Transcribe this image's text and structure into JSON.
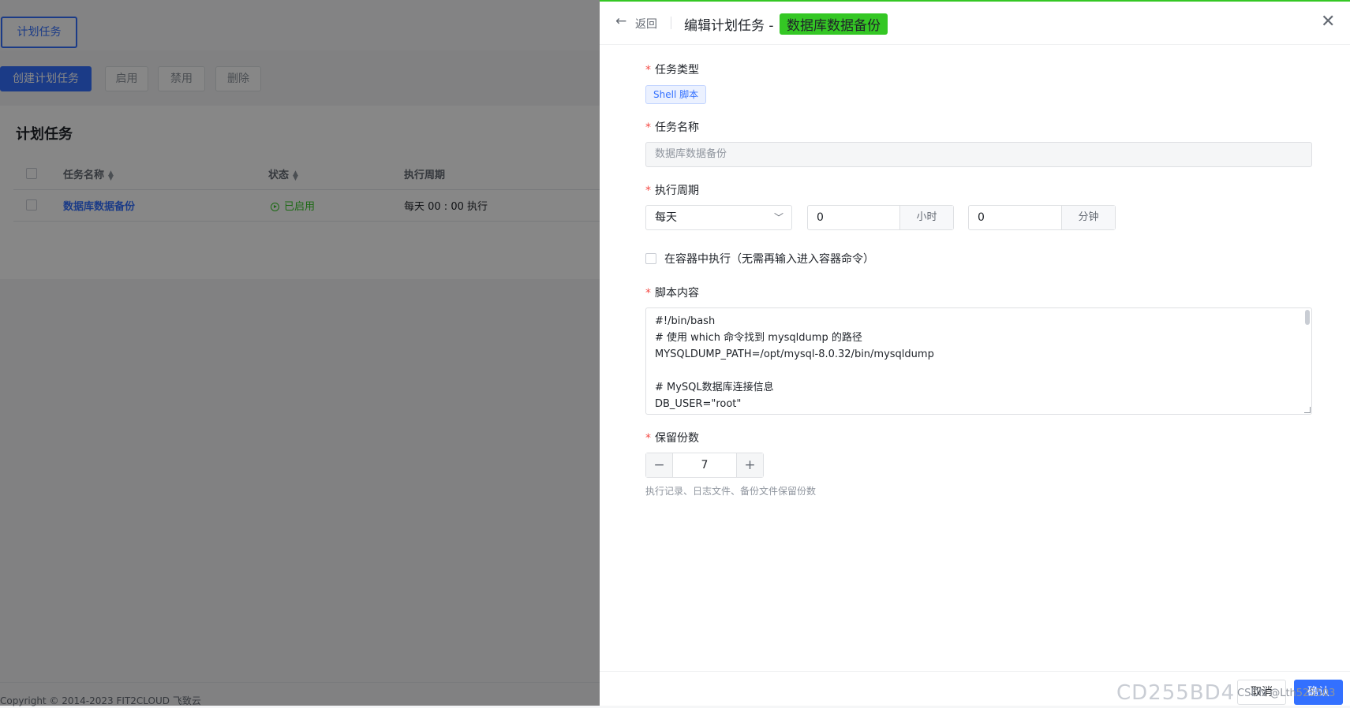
{
  "background": {
    "tab_label": "计划任务",
    "toolbar": {
      "create": "创建计划任务",
      "enable": "启用",
      "disable": "禁用",
      "delete": "删除"
    },
    "card_title": "计划任务",
    "table": {
      "headers": [
        "任务名称",
        "状态",
        "执行周期"
      ],
      "rows": [
        {
          "name": "数据库数据备份",
          "status": "已启用",
          "cycle": "每天 00 : 00 执行"
        }
      ]
    },
    "footer": "Copyright © 2014-2023 FIT2CLOUD 飞致云"
  },
  "drawer": {
    "back_label": "返回",
    "title_prefix": "编辑计划任务 -",
    "title_tag": "数据库数据备份",
    "form": {
      "task_type": {
        "label": "任务类型",
        "value": "Shell 脚本"
      },
      "task_name": {
        "label": "任务名称",
        "value": "数据库数据备份"
      },
      "cycle": {
        "label": "执行周期",
        "frequency": "每天",
        "hour_value": "0",
        "hour_unit": "小时",
        "minute_value": "0",
        "minute_unit": "分钟"
      },
      "container_checkbox": {
        "label": "在容器中执行（无需再输入进入容器命令）",
        "checked": false
      },
      "script": {
        "label": "脚本内容",
        "lines": [
          "#!/bin/bash",
          "# 使用 which 命令找到 mysqldump 的路径",
          "MYSQLDUMP_PATH=/opt/mysql-8.0.32/bin/mysqldump",
          "",
          "# MySQL数据库连接信息",
          "DB_USER=\"root\""
        ]
      },
      "retention": {
        "label": "保留份数",
        "value": "7",
        "minus": "−",
        "plus": "+",
        "hint": "执行记录、日志文件、备份文件保留份数"
      }
    },
    "footer": {
      "cancel": "取消",
      "confirm": "确认",
      "watermark_code": "CD255BD4",
      "watermark_csdn": "CSDN @Lth525503"
    }
  },
  "colors": {
    "primary": "#3370ff",
    "success": "#34c724",
    "required": "#f54a45"
  }
}
